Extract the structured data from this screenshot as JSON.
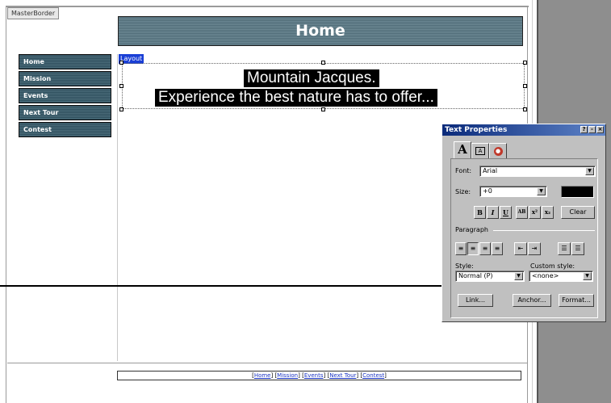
{
  "page": {
    "master_tag": "MasterBorder",
    "banner_title": "Home",
    "layout_tag": "Layout",
    "hero_line1": "Mountain Jacques.",
    "hero_line2": "Experience the best nature has to offer..."
  },
  "nav": {
    "items": [
      {
        "label": "Home"
      },
      {
        "label": "Mission"
      },
      {
        "label": "Events"
      },
      {
        "label": "Next Tour"
      },
      {
        "label": "Contest"
      }
    ]
  },
  "footer": {
    "links": [
      "Home",
      "Mission",
      "Events",
      "Next Tour",
      "Contest"
    ]
  },
  "palette": {
    "title": "Text Properties",
    "window_controls": [
      "?",
      "-",
      "×"
    ],
    "tabs": [
      {
        "name": "text-tab",
        "glyph": "A"
      },
      {
        "name": "table-cell-tab",
        "glyph": "A"
      },
      {
        "name": "action-tab",
        "glyph": "●"
      }
    ],
    "font_label": "Font:",
    "font_value": "Arial",
    "size_label": "Size:",
    "size_value": "+0",
    "text_color": "#000000",
    "style_buttons": [
      "B",
      "I",
      "U",
      "AB",
      "x²",
      "x₂"
    ],
    "clear_label": "Clear",
    "paragraph_label": "Paragraph",
    "style_label": "Style:",
    "style_value": "Normal (P)",
    "custom_style_label": "Custom style:",
    "custom_style_value": "<none>",
    "link_button": "Link...",
    "anchor_button": "Anchor...",
    "format_button": "Format..."
  }
}
